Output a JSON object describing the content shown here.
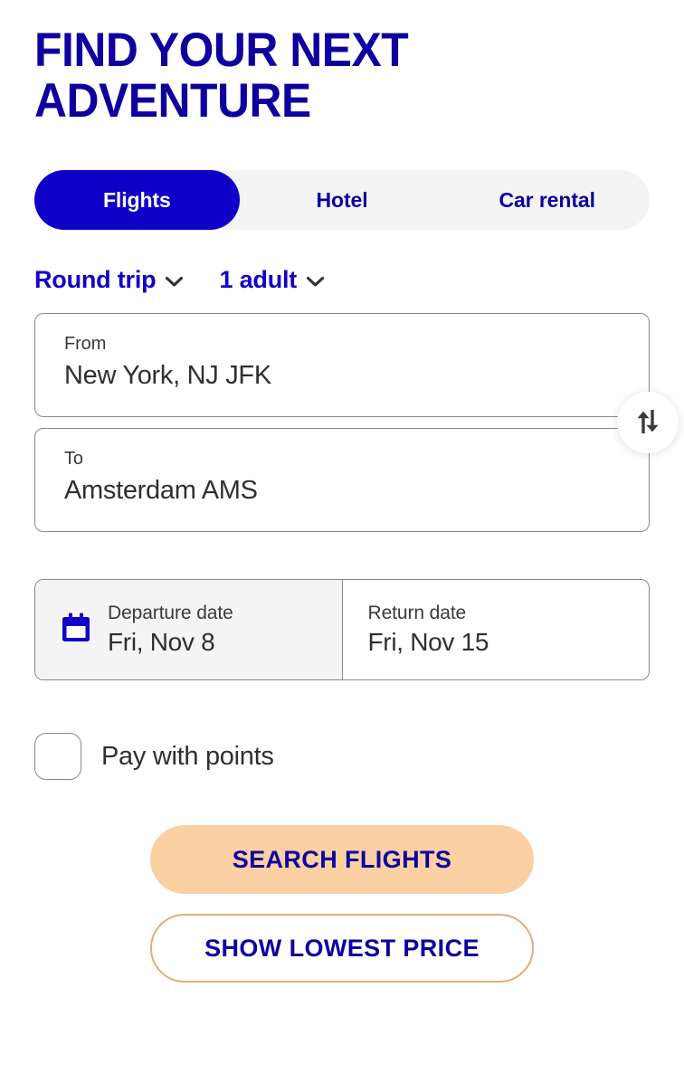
{
  "theme": {
    "brand_blue": "#1000c8",
    "heading_blue": "#0d009e",
    "accent_peach": "#fbd0a3",
    "accent_peach_border": "#e9a977",
    "track_gray": "#f4f4f5",
    "border_gray": "#8a8a8a",
    "text_dark": "#2f2f2f"
  },
  "heading": "Find your next\nadventure",
  "tabs": [
    {
      "label": "Flights",
      "active": true
    },
    {
      "label": "Hotel",
      "active": false
    },
    {
      "label": "Car rental",
      "active": false
    }
  ],
  "selectors": [
    {
      "label": "Round trip",
      "icon": "chevron-down-icon"
    },
    {
      "label": "1 adult",
      "icon": "chevron-down-icon"
    }
  ],
  "locations": {
    "from": {
      "label": "From",
      "value": "New York, NJ JFK"
    },
    "to": {
      "label": "To",
      "value": "Amsterdam AMS"
    },
    "swap_icon": "swap-vertical-icon"
  },
  "dates": {
    "icon": "calendar-icon",
    "departure": {
      "label": "Departure date",
      "value": "Fri, Nov 8",
      "selected": true
    },
    "return": {
      "label": "Return date",
      "value": "Fri, Nov 15",
      "selected": false
    }
  },
  "pay_with_points": {
    "label": "Pay with points",
    "checked": false
  },
  "actions": {
    "primary": "Search flights",
    "secondary": "Show lowest price"
  }
}
